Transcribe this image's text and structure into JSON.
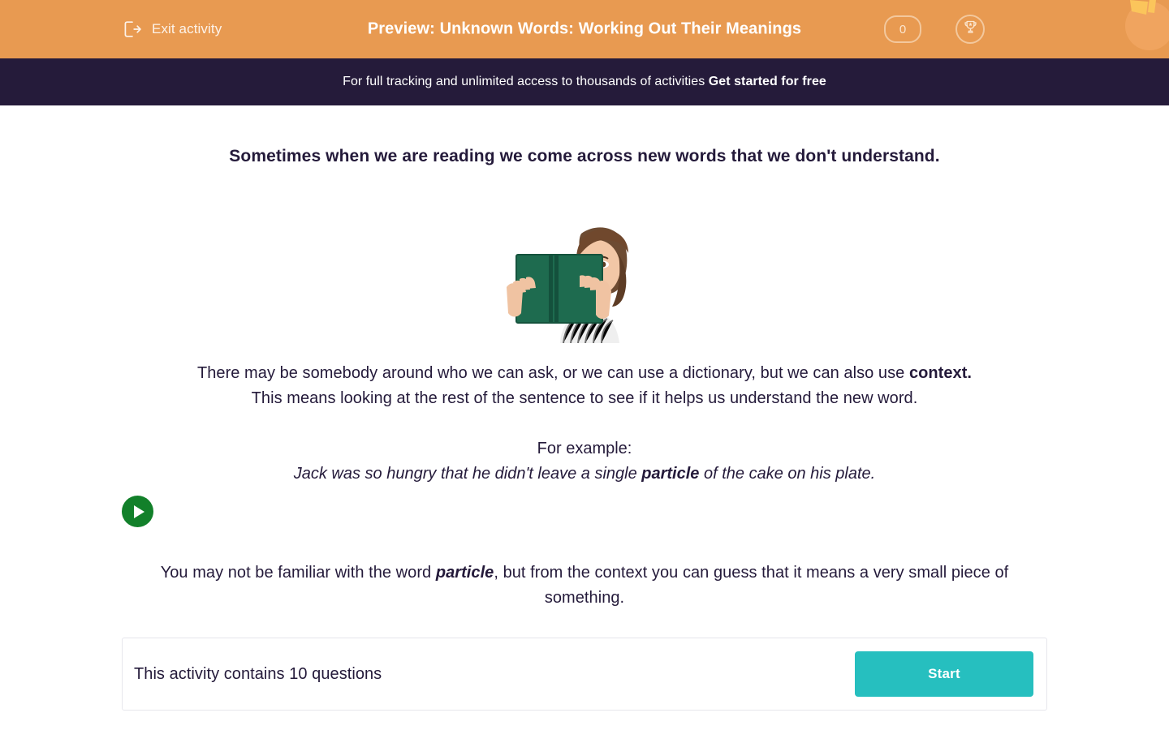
{
  "header": {
    "exit_label": "Exit activity",
    "exit_icon": "exit-arrow-icon",
    "title": "Preview: Unknown Words: Working Out Their Meanings",
    "score_value": "0",
    "trophy_icon": "trophy-icon",
    "brand_logo": "orange-fruit-logo",
    "background_color": "#e89a51"
  },
  "promo": {
    "text": "For full tracking and unlimited access to thousands of activities ",
    "link_label": "Get started for free",
    "background_color": "#251b3a"
  },
  "main": {
    "intro": "Sometimes when we are reading we come across new words that we don't understand.",
    "illustration_alt": "girl-holding-green-book",
    "paragraph": {
      "lead": "There may be somebody around who we can ask, or we can use a dictionary, but we can also use ",
      "emphasis": "context.",
      "second_line": "This means looking at the rest of the sentence to see if it helps us understand the new word."
    },
    "example": {
      "label": "For example:",
      "sentence_before": "Jack was so hungry that he didn't leave a single ",
      "sentence_keyword": "particle",
      "sentence_after": " of the cake on his plate."
    },
    "audio": {
      "play_icon": "play-icon",
      "color": "#12802a"
    },
    "closing": {
      "before": "You may not be familiar with the word ",
      "keyword": "particle",
      "after": ", but from the context you can guess that it means a very small piece of something."
    }
  },
  "footer": {
    "question_count_text": "This activity contains 10 questions",
    "start_label": "Start",
    "start_color": "#26bfbf"
  }
}
